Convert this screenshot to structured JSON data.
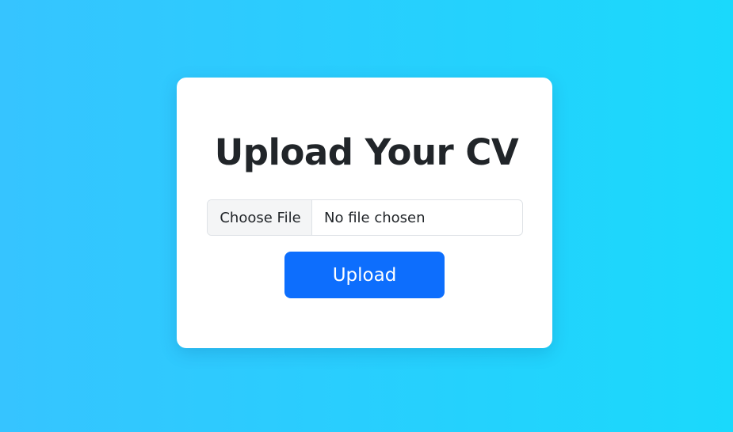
{
  "card": {
    "title": "Upload Your CV"
  },
  "file_input": {
    "button_label": "Choose File",
    "status_text": "No file chosen"
  },
  "upload_button": {
    "label": "Upload"
  },
  "colors": {
    "background_start": "#36c4ff",
    "background_end": "#1ad9fc",
    "primary": "#0d6efd",
    "card": "#ffffff",
    "text": "#212529"
  }
}
